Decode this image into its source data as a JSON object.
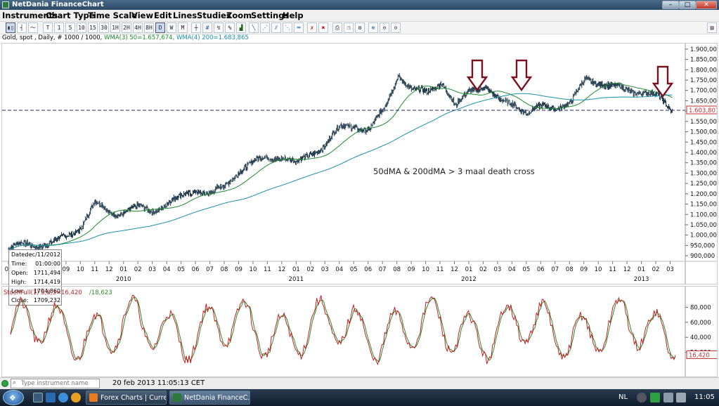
{
  "window": {
    "title": "NetDania FinanceChart",
    "min_label": "–",
    "max_label": "□",
    "close_label": "✕"
  },
  "menu": [
    "Instruments",
    "Chart Type",
    "Time Scale",
    "View",
    "Edit",
    "Lines",
    "Studies",
    "Zoom",
    "Settings",
    "Help"
  ],
  "toolbar": {
    "time_buttons": [
      "T",
      "1",
      "5",
      "10",
      "15",
      "30",
      "1H",
      "2H",
      "4H",
      "8H",
      "D",
      "W",
      "M"
    ],
    "active_period": "D"
  },
  "info_line": {
    "instrument": "Gold, spot , Daily, # 1000 / 1000,",
    "wma50": "WMA(3) 50=1.657,674,",
    "wma200": "WMA(4) 200=1.683,865"
  },
  "price_axis": [
    "1.900,000",
    "1.850,000",
    "1.800,000",
    "1.750,000",
    "1.700,000",
    "1.650,000",
    "1.600,000",
    "1.550,000",
    "1.500,000",
    "1.450,000",
    "1.400,000",
    "1.350,000",
    "1.300,000",
    "1.250,000",
    "1.200,000",
    "1.150,000",
    "1.100,000",
    "1.050,000",
    "1.000,000",
    "950,000",
    "900,000"
  ],
  "current_price": "1.603,807",
  "month_axis": [
    "05",
    "06",
    "07",
    "08",
    "09",
    "10",
    "11",
    "12",
    "01",
    "02",
    "03",
    "04",
    "05",
    "06",
    "07",
    "08",
    "09",
    "10",
    "11",
    "12",
    "01",
    "02",
    "03",
    "04",
    "05",
    "06",
    "07",
    "08",
    "09",
    "10",
    "11",
    "12",
    "01",
    "02",
    "03",
    "04",
    "05",
    "06",
    "07",
    "08",
    "09",
    "10",
    "11",
    "12",
    "01",
    "02",
    "03"
  ],
  "years": [
    "2010",
    "2011",
    "2012",
    "2013"
  ],
  "annotation": "50dMA & 200dMA > 3 maal death cross",
  "info_box": {
    "date": {
      "label": "Date:",
      "value": "dec/11/2012"
    },
    "time": {
      "label": "Time:",
      "value": "01:00:00"
    },
    "open": {
      "label": "Open:",
      "value": "1711,494"
    },
    "high": {
      "label": "High:",
      "value": "1714,419"
    },
    "low": {
      "label": "Low:",
      "value": "1704,860"
    },
    "close": {
      "label": "Close:",
      "value": "1709,232"
    }
  },
  "stoch": {
    "label_main": "StochFull(1) 5,8,3=16,420",
    "label_signal": "/18,623",
    "axis": [
      "80,000",
      "60,000",
      "40,000",
      "20,000"
    ],
    "current": "16,420"
  },
  "colors": {
    "candle": "#0d2a3d",
    "wma50": "#1e8a2e",
    "wma200": "#1b8fa8",
    "arrow": "#7a1020",
    "stoch_main": "#c02020",
    "stoch_signal": "#2c8a2c",
    "level_line": "#1a2a6a"
  },
  "chart_data": {
    "type": "line",
    "title": "Gold, spot , Daily",
    "ylim": [
      880,
      1920
    ],
    "x": [
      "2009-05",
      "2009-06",
      "2009-07",
      "2009-08",
      "2009-09",
      "2009-10",
      "2009-11",
      "2009-12",
      "2010-01",
      "2010-02",
      "2010-03",
      "2010-04",
      "2010-05",
      "2010-06",
      "2010-07",
      "2010-08",
      "2010-09",
      "2010-10",
      "2010-11",
      "2010-12",
      "2011-01",
      "2011-02",
      "2011-03",
      "2011-04",
      "2011-05",
      "2011-06",
      "2011-07",
      "2011-08",
      "2011-09",
      "2011-10",
      "2011-11",
      "2011-12",
      "2012-01",
      "2012-02",
      "2012-03",
      "2012-04",
      "2012-05",
      "2012-06",
      "2012-07",
      "2012-08",
      "2012-09",
      "2012-10",
      "2012-11",
      "2012-12",
      "2013-01",
      "2013-02",
      "2013-03"
    ],
    "series": [
      {
        "values": [
          930,
          940,
          935,
          950,
          1000,
          1060,
          1170,
          1110,
          1100,
          1110,
          1110,
          1160,
          1200,
          1240,
          1200,
          1220,
          1300,
          1340,
          1380,
          1400,
          1360,
          1400,
          1430,
          1500,
          1520,
          1510,
          1620,
          1800,
          1700,
          1680,
          1730,
          1600,
          1710,
          1740,
          1660,
          1650,
          1580,
          1600,
          1610,
          1640,
          1770,
          1760,
          1720,
          1690,
          1680,
          1650,
          1600
        ]
      }
    ],
    "horizontal_line": 1603.807,
    "stoch_axis": [
      20,
      40,
      60,
      80
    ]
  }
}
